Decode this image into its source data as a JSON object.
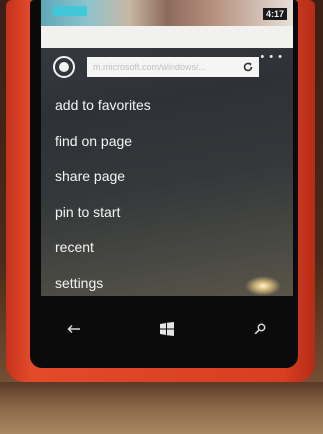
{
  "status_bar": {
    "time": "4:17"
  },
  "appbar": {
    "address_text": "m.microsoft.com/windows/..."
  },
  "menu": {
    "items": [
      {
        "id": "add-to-favorites",
        "label": "add to favorites"
      },
      {
        "id": "find-on-page",
        "label": "find on page"
      },
      {
        "id": "share-page",
        "label": "share page"
      },
      {
        "id": "pin-to-start",
        "label": "pin to start"
      },
      {
        "id": "recent",
        "label": "recent"
      },
      {
        "id": "settings",
        "label": "settings"
      }
    ]
  },
  "navbar": {
    "buttons": [
      {
        "id": "back",
        "icon": "back-arrow-icon"
      },
      {
        "id": "start",
        "icon": "windows-logo-icon"
      },
      {
        "id": "search",
        "icon": "search-icon"
      }
    ]
  },
  "colors": {
    "case": "#d83e22",
    "menu_text": "#f4f4f4",
    "accent_teal": "#41c8d8"
  }
}
